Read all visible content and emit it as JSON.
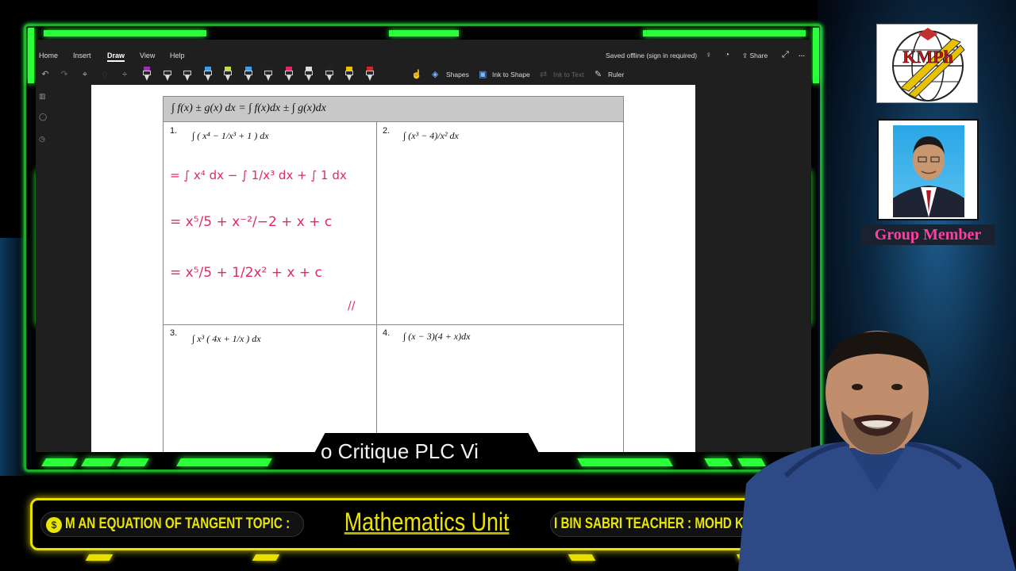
{
  "app": {
    "tabs": [
      "Home",
      "Insert",
      "Draw",
      "View",
      "Help"
    ],
    "active_tab": "Draw",
    "status_text": "Saved offline (sign in required)",
    "share_label": "Share",
    "more_label": "···",
    "tools": {
      "shapes": "Shapes",
      "ink_to_shape": "Ink to Shape",
      "ink_to_text": "Ink to Text",
      "ruler": "Ruler"
    },
    "pen_colors": [
      "#9b2fb5",
      "#222222",
      "#222222",
      "#3aa0e6",
      "#c8d84a",
      "#3aa0e6",
      "#222222",
      "#e0286c",
      "#dddddd",
      "#222222",
      "#e8c200",
      "#d22626"
    ]
  },
  "worksheet": {
    "header_formula": "∫ f(x) ± g(x) dx = ∫ f(x)dx ± ∫ g(x)dx",
    "questions": [
      {
        "num": "1.",
        "expr": "∫ ( x⁴ − 1/x³ + 1 ) dx"
      },
      {
        "num": "2.",
        "expr": "∫ (x³ − 4)/x² dx"
      },
      {
        "num": "3.",
        "expr": "∫ x³ ( 4x + 1/x ) dx"
      },
      {
        "num": "4.",
        "expr": "∫ (x − 3)(4 + x)dx"
      }
    ],
    "ink_lines": [
      "= ∫ x⁴ dx − ∫ 1/x³ dx + ∫ 1 dx",
      "= x⁵/5 + x⁻²/−2 + x + c",
      "= x⁵/5 + 1/2x² + x + c",
      "//"
    ]
  },
  "overlay_title": "o Critique   PLC  Vi",
  "ticker": {
    "left_text": "M AN EQUATION OF TANGENT   TOPIC :",
    "center_title": "Mathematics Unit",
    "right_text": "I BIN SABRI    TEACHER : MOHD KHAIRI"
  },
  "logo_text": "KMPh",
  "group_member_label": "Group Member",
  "colors": {
    "frame_green": "#2bff3a",
    "ticker_yellow": "#e8e600",
    "ink_pink": "#e0286c",
    "group_member_pink": "#ff3ea0"
  }
}
